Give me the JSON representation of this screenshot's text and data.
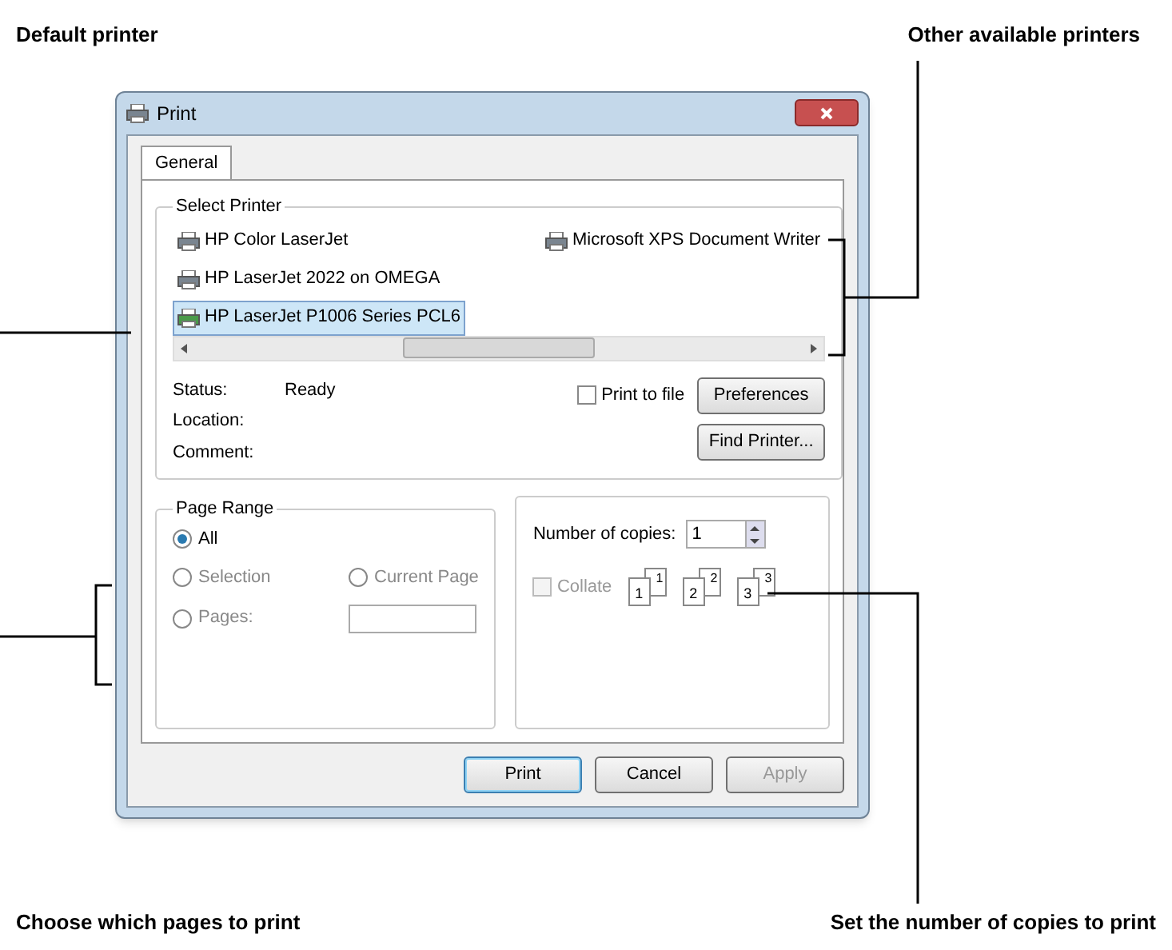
{
  "callouts": {
    "top_left": "Default printer",
    "top_right": "Other available printers",
    "bottom_left": "Choose which pages to print",
    "bottom_right": "Set the number of copies to print"
  },
  "window": {
    "title": "Print"
  },
  "tabs": [
    {
      "label": "General",
      "selected": true
    }
  ],
  "select_printer": {
    "title": "Select Printer",
    "printers": [
      {
        "name": "HP Color LaserJet",
        "selected": false
      },
      {
        "name": "HP LaserJet 2022 on OMEGA",
        "selected": false
      },
      {
        "name": "HP LaserJet P1006 Series PCL6",
        "selected": true
      },
      {
        "name": "Microsoft XPS Document Writer",
        "selected": false
      }
    ],
    "info": [
      {
        "label": "Status:",
        "value": "Ready"
      },
      {
        "label": "Location:"
      },
      {
        "label": "Comment:"
      }
    ],
    "print_to_file": {
      "label": "Print to file",
      "checked": false
    },
    "buttons": [
      "Preferences",
      "Find Printer..."
    ]
  },
  "page_range": {
    "title": "Page Range",
    "options": [
      {
        "label": "All",
        "selected": true
      },
      {
        "label": "Selection",
        "selected": false
      },
      {
        "label": "Current Page",
        "selected": false
      },
      {
        "label": "Pages:",
        "selected": false
      }
    ]
  },
  "copies": {
    "label": "Number of copies:",
    "value": "1",
    "collate": {
      "label": "Collate",
      "checked": false,
      "disabled": true
    },
    "collate_pages": [
      {
        "back": "1",
        "front": "1"
      },
      {
        "back": "2",
        "front": "2"
      },
      {
        "back": "3",
        "front": "3"
      }
    ]
  },
  "buttons": [
    {
      "label": "Print",
      "disabled": false,
      "default": true
    },
    {
      "label": "Cancel",
      "disabled": false,
      "default": false
    },
    {
      "label": "Apply",
      "disabled": true,
      "default": false
    }
  ]
}
